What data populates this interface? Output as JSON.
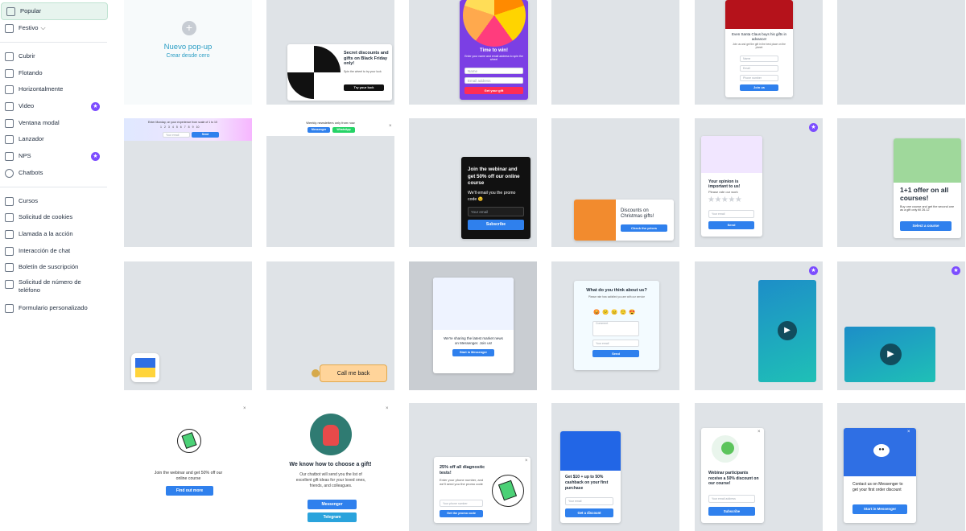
{
  "sidebar": {
    "items": [
      {
        "label": "Popular",
        "icon": "grid-icon"
      },
      {
        "label": "Festivo",
        "icon": "tree-icon"
      },
      {
        "label": "Cubrir",
        "icon": "cover-icon"
      },
      {
        "label": "Flotando",
        "icon": "floating-icon"
      },
      {
        "label": "Horizontalmente",
        "icon": "horizontal-icon"
      },
      {
        "label": "Video",
        "icon": "video-icon"
      },
      {
        "label": "Ventana modal",
        "icon": "modal-icon"
      },
      {
        "label": "Lanzador",
        "icon": "launcher-icon"
      },
      {
        "label": "NPS",
        "icon": "nps-icon"
      },
      {
        "label": "Chatbots",
        "icon": "chatbot-icon"
      },
      {
        "label": "Cursos",
        "icon": "courses-icon"
      },
      {
        "label": "Solicitud de cookies",
        "icon": "cookie-icon"
      },
      {
        "label": "Llamada a la acción",
        "icon": "cta-icon"
      },
      {
        "label": "Interacción de chat",
        "icon": "chat-icon"
      },
      {
        "label": "Boletín de suscripción",
        "icon": "newsletter-icon"
      },
      {
        "label": "Solicitud de número de teléfono",
        "icon": "phone-icon"
      },
      {
        "label": "Formulario personalizado",
        "icon": "form-icon"
      }
    ]
  },
  "new_popup": {
    "title": "Nuevo pop-up",
    "subtitle": "Crear desde cero",
    "icon": "plus-icon"
  },
  "colors": {
    "accent": "#2f80ed",
    "premium": "#7c4dff",
    "active_bg": "#e7f4ee",
    "tile_bg": "#dfe3e7"
  },
  "tiles": {
    "wheel": {
      "title": "Secret discounts and gifts on Black Friday only!",
      "text": "Spin the wheel to try your luck",
      "button": "Try your luck"
    },
    "spin": {
      "title": "Time to win!",
      "text": "Enter your name and email address to spin the wheel",
      "name": "Name",
      "email": "Email address",
      "button": "Get your gift"
    },
    "santa": {
      "title": "Even Santa Claus buys his gifts in advance!",
      "text": "Join us and get the gift in the best place on the planet",
      "name": "Name",
      "email": "Email",
      "phone": "Phone number",
      "button": "Join us"
    },
    "bar1": {
      "text": "Enter Monday, on your experience from scale of 1 to 10",
      "numbers": [
        "1",
        "2",
        "3",
        "4",
        "5",
        "6",
        "7",
        "8",
        "9",
        "10"
      ],
      "input": "Your email",
      "button": "Send"
    },
    "bar2": {
      "text": "Weekly newsletters only from now",
      "btn1": "Messenger",
      "btn2": "WhatsApp"
    },
    "webinar_dark": {
      "title": "Join the webinar and get 50% off our online course",
      "text": "We'll email you the promo code 😉",
      "input": "Your email",
      "button": "Subscribe"
    },
    "christmas": {
      "title": "Discounts on Christmas gifts!",
      "button": "Check the prices"
    },
    "opinion": {
      "title": "Your opinion is important to us!",
      "text": "Please rate our work",
      "input": "Your email",
      "button": "Send"
    },
    "courses": {
      "title": "1+1 offer on all courses!",
      "text": "Buy one course and get the second one as a gift only till 26.12",
      "button": "Select a course"
    },
    "callme": {
      "button": "Call me back"
    },
    "market": {
      "text": "We're sharing the latest market news on Messenger. Join us!",
      "button": "Start in Messenger"
    },
    "think": {
      "title": "What do you think about us?",
      "text": "Please rate how satisfied you are with our service",
      "input": "Comment",
      "email": "Your email",
      "button": "Send"
    },
    "webinar_white": {
      "text": "Join the webinar and get 50% off our online course",
      "button": "Find out more"
    },
    "gift": {
      "title": "We know how to choose a gift!",
      "text": "Our chatbot will send you the list of excellent gift ideas for your loved ones, friends, and colleagues.",
      "btn1": "Messenger",
      "btn2": "Telegram"
    },
    "diag": {
      "title": "25% off all diagnostic tests!",
      "text": "Enter your phone number, and we'll send you the promo code",
      "input": "Your phone number",
      "button": "Get the promo code"
    },
    "cashback": {
      "title": "Get $10 + up to 50% cashback on your first purchase",
      "input": "Your email",
      "button": "Get a discount"
    },
    "webinar_part": {
      "title": "Webinar participants receive a 50% discount on our course!",
      "input": "Your email address",
      "button": "Subscribe"
    },
    "contact": {
      "text": "Contact us on Messenger to get your first order discount",
      "button": "Start in Messenger"
    }
  }
}
